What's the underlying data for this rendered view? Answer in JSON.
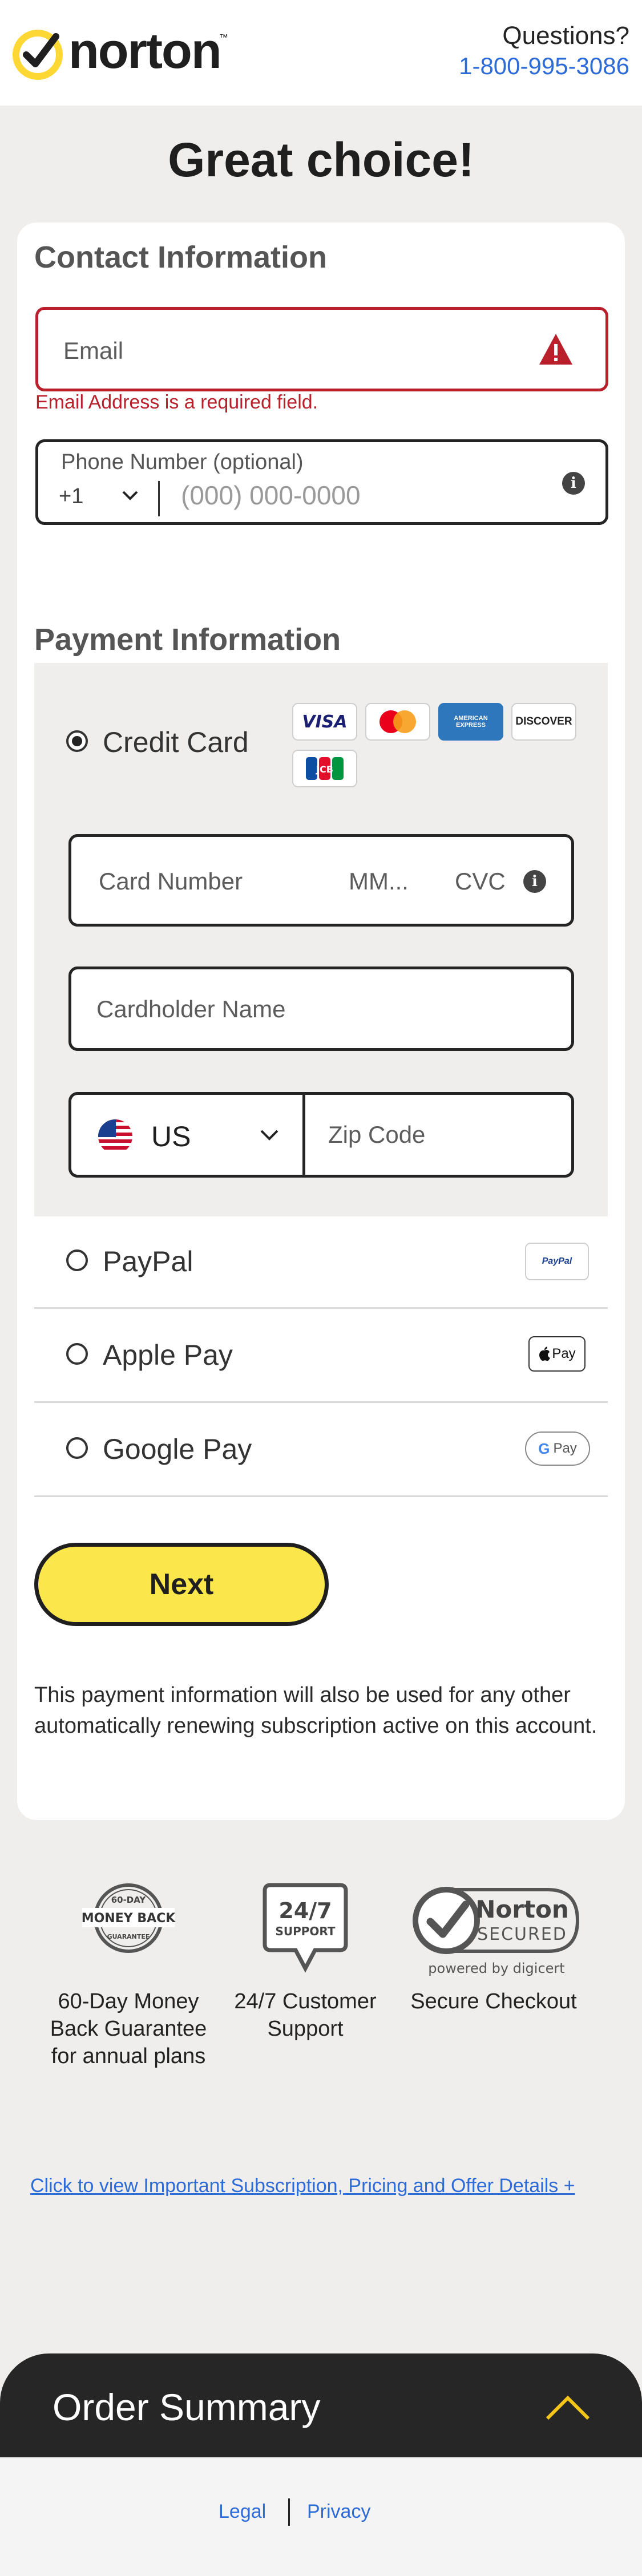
{
  "header": {
    "logo_text": "norton",
    "logo_tm": "™",
    "questions": "Questions?",
    "phone": "1-800-995-3086"
  },
  "page_title": "Great choice!",
  "contact": {
    "title": "Contact Information",
    "email_placeholder": "Email",
    "email_error": "Email Address is a required field.",
    "phone_label": "Phone Number (optional)",
    "country_code": "+1",
    "phone_placeholder": "(000) 000-0000"
  },
  "payment": {
    "title": "Payment Information",
    "credit_card": {
      "label": "Credit Card",
      "selected": true,
      "brands": [
        "VISA",
        "Mastercard",
        "AMERICAN EXPRESS",
        "DISCOVER",
        "JCB"
      ],
      "card_number_placeholder": "Card Number",
      "expiry_placeholder": "MM...",
      "cvc_placeholder": "CVC",
      "cardholder_placeholder": "Cardholder Name",
      "country": "US",
      "zip_placeholder": "Zip Code"
    },
    "options": [
      {
        "label": "PayPal",
        "badge": "PayPal"
      },
      {
        "label": "Apple Pay",
        "badge": "Pay"
      },
      {
        "label": "Google Pay",
        "badge": "Pay"
      }
    ],
    "next_label": "Next",
    "note": "This payment information will also be used for any other automatically renewing subscription active on this account."
  },
  "trust": {
    "money_back": {
      "badge_top": "60-DAY",
      "badge_mid": "MONEY BACK",
      "badge_bottom": "GUARANTEE",
      "label": "60-Day Money Back Guarantee for annual plans"
    },
    "support": {
      "badge_top": "24/7",
      "badge_bottom": "SUPPORT",
      "label": "24/7 Customer Support"
    },
    "secure": {
      "badge_brand": "Norton",
      "badge_word": "SECURED",
      "powered": "powered by digicert",
      "label": "Secure Checkout"
    }
  },
  "details_link": "Click to view Important Subscription, Pricing and Offer Details +",
  "order_summary": {
    "title": "Order Summary",
    "toggle_icon": "chevron-up-icon"
  },
  "footer": {
    "legal": "Legal",
    "privacy": "Privacy"
  },
  "colors": {
    "brand_yellow": "#FBE74B",
    "error_red": "#B8202C",
    "link_blue": "#2D6BD8"
  }
}
